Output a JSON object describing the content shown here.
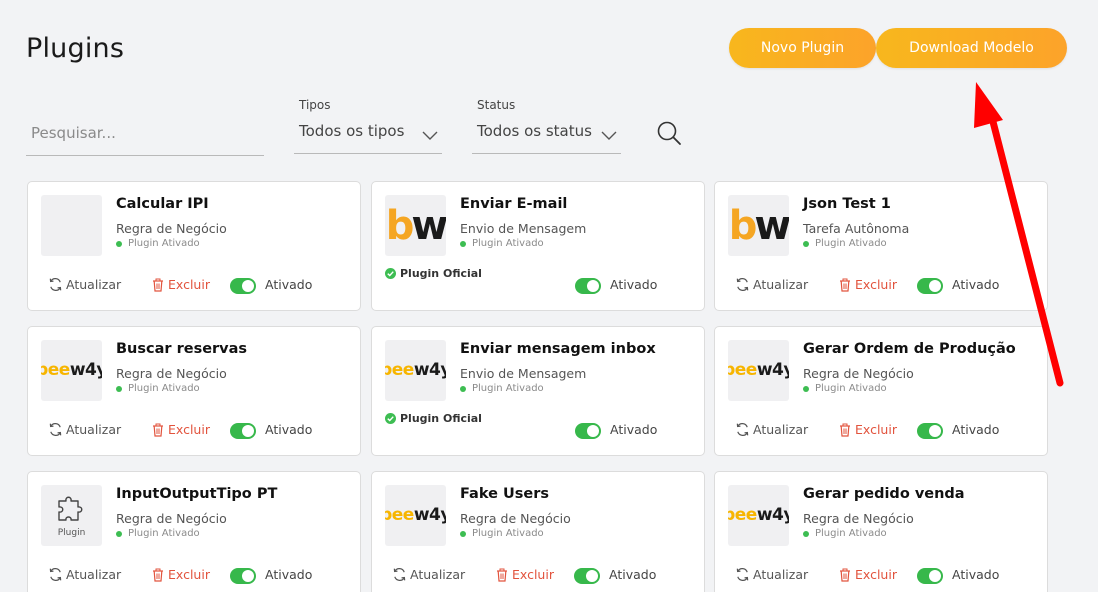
{
  "header": {
    "title": "Plugins",
    "new_plugin_label": "Novo Plugin",
    "download_model_label": "Download Modelo"
  },
  "filters": {
    "search_placeholder": "Pesquisar...",
    "types_label": "Tipos",
    "types_value": "Todos os tipos",
    "status_label": "Status",
    "status_value": "Todos os status"
  },
  "labels": {
    "update": "Atualizar",
    "delete": "Excluir",
    "enabled": "Ativado",
    "plugin_enabled": "Plugin Ativado",
    "official": "Plugin Oficial",
    "plugin_thumb": "Plugin"
  },
  "logos": {
    "bw_b": "b",
    "bw_w": "w",
    "bee": "bee",
    "way": "w4y"
  },
  "colors": {
    "accent": "#f8b71d",
    "toggle_on": "#37b84b",
    "delete": "#e2533d",
    "arrow": "#ff0000"
  },
  "plugins": [
    {
      "title": "Calcular IPI",
      "type": "Regra de Negócio",
      "logo": "blank",
      "official": false,
      "enabled": true
    },
    {
      "title": "Enviar E-mail",
      "type": "Envio de Mensagem",
      "logo": "bw",
      "official": true,
      "enabled": true
    },
    {
      "title": "Json Test 1",
      "type": "Tarefa Autônoma",
      "logo": "bw",
      "official": false,
      "enabled": true
    },
    {
      "title": "Buscar reservas",
      "type": "Regra de Negócio",
      "logo": "beeway",
      "official": false,
      "enabled": true
    },
    {
      "title": "Enviar mensagem inbox",
      "type": "Envio de Mensagem",
      "logo": "beeway",
      "official": true,
      "enabled": true
    },
    {
      "title": "Gerar Ordem de Produção",
      "type": "Regra de Negócio",
      "logo": "beeway",
      "official": false,
      "enabled": true
    },
    {
      "title": "InputOutputTipo PT",
      "type": "Regra de Negócio",
      "logo": "puzzle-icon",
      "official": false,
      "enabled": true
    },
    {
      "title": "Fake Users",
      "type": "Regra de Negócio",
      "logo": "beeway",
      "official": false,
      "enabled": true
    },
    {
      "title": "Gerar pedido venda",
      "type": "Regra de Negócio",
      "logo": "beeway",
      "official": false,
      "enabled": true
    }
  ]
}
